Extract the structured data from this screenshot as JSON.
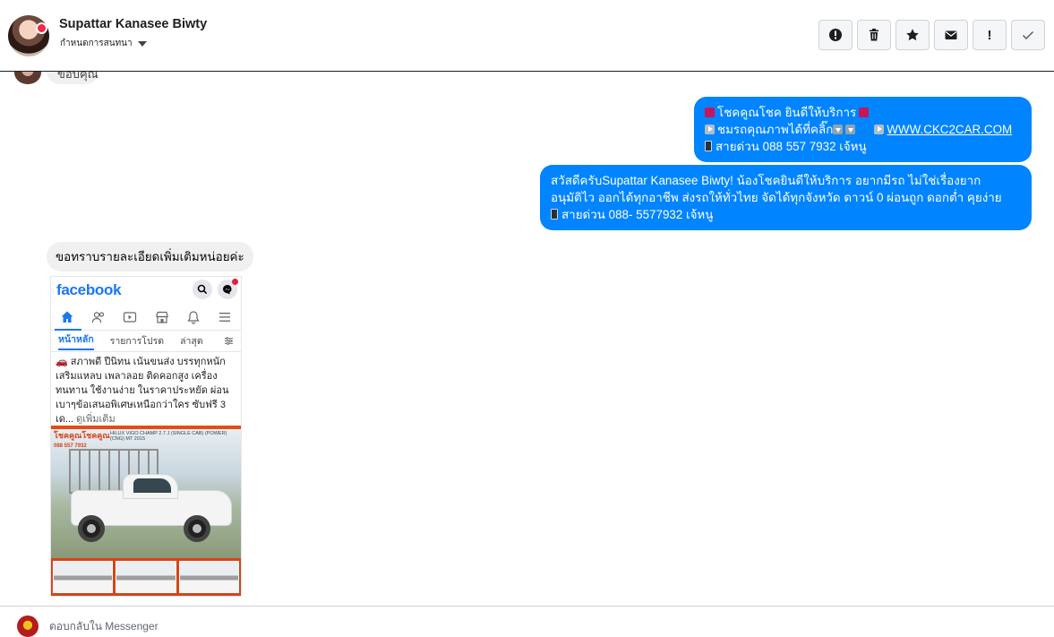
{
  "header": {
    "contact_name": "Supattar Kanasee Biwty",
    "contact_sub": "กำหนดการสนทนา",
    "actions": [
      {
        "name": "report-spam-button",
        "icon": "alert-circle-icon",
        "text": ""
      },
      {
        "name": "delete-button",
        "icon": "trash-icon",
        "text": ""
      },
      {
        "name": "star-button",
        "icon": "star-icon",
        "text": ""
      },
      {
        "name": "mark-unread-button",
        "icon": "envelope-icon",
        "text": ""
      },
      {
        "name": "priority-button",
        "icon": "exclamation-icon",
        "text": "!"
      },
      {
        "name": "mark-done-button",
        "icon": "checkmark-icon",
        "text": ""
      }
    ]
  },
  "thread": {
    "prev_bubble_text": "ขอบคุณ",
    "outgoing_1": {
      "line1": "โชคคูณโชค ยินดีให้บริการ",
      "line2_text": "ชมรถคุณภาพได้ที่คลิ๊ก",
      "line2_link": "WWW.CKC2CAR.COM",
      "line3": "สายด่วน 088 557 7932 เจ้หนู"
    },
    "outgoing_2": {
      "line1": "สวัสดีครับSupattar Kanasee Biwty! น้องโชคยินดีให้บริการ อยากมีรถ ไม่ใช่เรื่องยาก",
      "line2": "อนุมัติไว ออกได้ทุกอาชีพ ส่งรถให้ทั่วไทย จัดได้ทุกจังหวัด ดาวน์ 0  ผ่อนถูก ดอกต่ำ คุยง่าย",
      "line3": "สายด่วน 088- 5577932 เจ้หนู"
    },
    "incoming_1": "ขอทราบรายละเอียดเพิ่มเติมหน่อยค่ะ"
  },
  "attachment": {
    "logo": "facebook",
    "tabs": [
      "หน้าหลัก",
      "รายการโปรด",
      "ล่าสุด"
    ],
    "post_text": "🚗 สภาพดี ปีนิทน เน้นขนส่ง บรรทุกหนัก เสริมแหลบ เพลาลอย ติดคอกสูง เครื่อง ทนทาน ใช้งานง่าย ในราคาประหยัด ผ่อน เบาๆข้อเสนอพิเศษเหนือกว่าใคร ซับฟรี 3 เด...",
    "see_more": "ดูเพิ่มเติม",
    "ad_brand": "โชคคูณโชคคูณ",
    "ad_phone": "088 557 7932",
    "ad_model": "HILUX VIGO CHAMP 2.7 J (SINGLE CAB) (POWER) (CNG) MT 2015"
  },
  "footer": {
    "text": "ตอบกลับใน Messenger"
  },
  "colors": {
    "accent": "#0084ff",
    "incoming_bubble": "#f0f0f0",
    "fb_blue": "#1877f2"
  }
}
